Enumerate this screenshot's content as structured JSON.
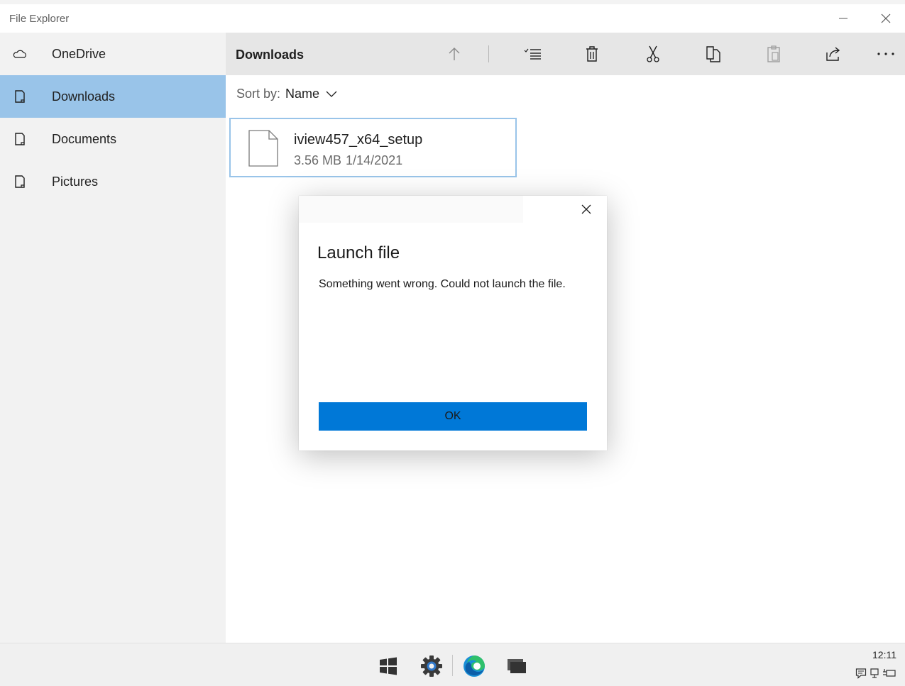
{
  "window": {
    "title": "File Explorer",
    "minimize_icon": "minimize-icon",
    "close_icon": "close-icon"
  },
  "sidebar": {
    "items": [
      {
        "label": "OneDrive",
        "icon": "cloud-icon",
        "selected": false
      },
      {
        "label": "Downloads",
        "icon": "folder-icon",
        "selected": true
      },
      {
        "label": "Documents",
        "icon": "folder-icon",
        "selected": false
      },
      {
        "label": "Pictures",
        "icon": "folder-icon",
        "selected": false
      }
    ]
  },
  "commandbar": {
    "folder_title": "Downloads",
    "commands": [
      "up-arrow-icon",
      "select-list-icon",
      "delete-icon",
      "cut-icon",
      "copy-icon",
      "paste-icon",
      "share-icon",
      "more-icon"
    ]
  },
  "sort": {
    "label": "Sort by:",
    "value": "Name"
  },
  "file": {
    "name": "iview457_x64_setup",
    "size": "3.56 MB",
    "date": "1/14/2021"
  },
  "dialog": {
    "title": "Launch file",
    "message": "Something went wrong. Could not launch the file.",
    "ok_label": "OK"
  },
  "taskbar": {
    "icons": [
      "windows-start-icon",
      "settings-gear-icon",
      "edge-browser-icon",
      "task-view-icon"
    ],
    "clock": "12:11"
  },
  "colors": {
    "accent": "#0078d7",
    "selection": "#99c4e9",
    "sidebar_bg": "#f2f2f2",
    "commandbar_bg": "#e6e6e6"
  }
}
